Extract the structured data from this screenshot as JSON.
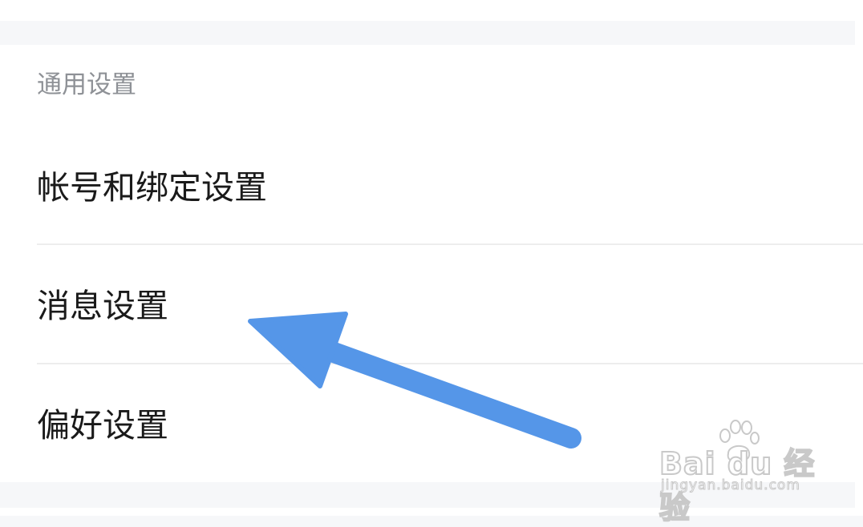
{
  "section": {
    "header": "通用设置"
  },
  "settings_items": [
    {
      "label": "帐号和绑定设置"
    },
    {
      "label": "消息设置"
    },
    {
      "label": "偏好设置"
    }
  ],
  "annotation": {
    "arrow_color": "#5596e8",
    "points_to": "消息设置"
  },
  "watermark": {
    "logo_text": "Bai du 经验",
    "url_text": "jingyan.baidu.com"
  },
  "colors": {
    "background": "#f6f7f9",
    "card": "#ffffff",
    "header_text": "#8e9196",
    "item_text": "#1a1a1a",
    "divider": "#ededed"
  }
}
